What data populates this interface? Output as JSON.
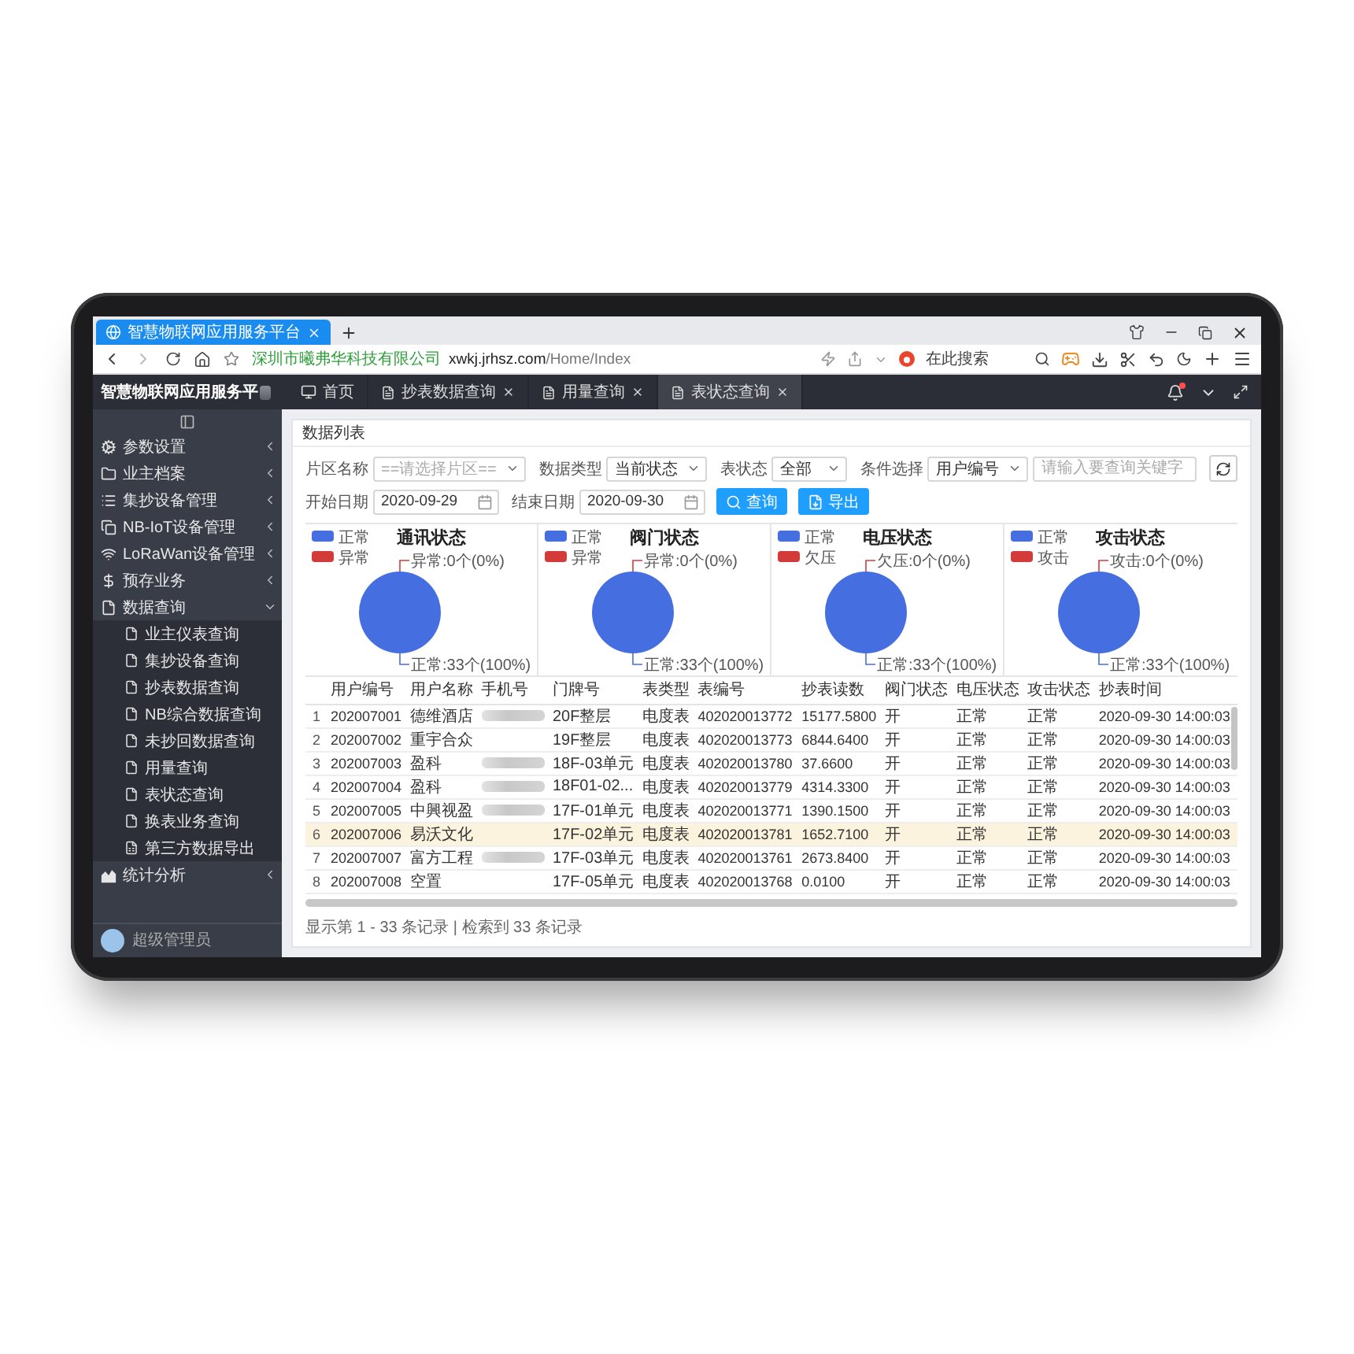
{
  "browser": {
    "tabs": [
      {
        "title": "智慧物联网应用服务平台",
        "selected": true
      }
    ],
    "address": {
      "site_name": "深圳市曦弗华科技有限公司",
      "host": "xwkj.jrhsz.com",
      "path": "/Home/Index"
    },
    "search": {
      "placeholder": "在此搜索"
    }
  },
  "app": {
    "title": "智慧物联网应用服务平",
    "tabs": [
      {
        "label": "首页",
        "kind": "home",
        "selected": false
      },
      {
        "label": "抄表数据查询",
        "kind": "page",
        "selected": false
      },
      {
        "label": "用量查询",
        "kind": "page",
        "selected": false
      },
      {
        "label": "表状态查询",
        "kind": "page",
        "selected": true
      }
    ]
  },
  "sidebar": {
    "items": [
      {
        "label": "参数设置",
        "expanded": false
      },
      {
        "label": "业主档案",
        "expanded": false
      },
      {
        "label": "集抄设备管理",
        "expanded": false
      },
      {
        "label": "NB-IoT设备管理",
        "expanded": false
      },
      {
        "label": "LoRaWan设备管理",
        "expanded": false
      },
      {
        "label": "预存业务",
        "expanded": false
      },
      {
        "label": "数据查询",
        "expanded": true,
        "children": [
          {
            "label": "业主仪表查询"
          },
          {
            "label": "集抄设备查询"
          },
          {
            "label": "抄表数据查询"
          },
          {
            "label": "NB综合数据查询"
          },
          {
            "label": "未抄回数据查询"
          },
          {
            "label": "用量查询"
          },
          {
            "label": "表状态查询"
          },
          {
            "label": "换表业务查询"
          },
          {
            "label": "第三方数据导出"
          }
        ]
      },
      {
        "label": "统计分析",
        "expanded": false
      }
    ],
    "user": {
      "name": "超级管理员"
    }
  },
  "panel": {
    "title": "数据列表",
    "filters": [
      {
        "kind": "select",
        "label": "片区名称",
        "placeholder": "==请选择片区=="
      },
      {
        "kind": "select",
        "label": "数据类型",
        "value": "当前状态"
      },
      {
        "kind": "select",
        "label": "表状态",
        "value": "全部"
      },
      {
        "kind": "select",
        "label": "条件选择",
        "value": "用户编号"
      },
      {
        "kind": "input",
        "placeholder": "请输入要查询关键字"
      },
      {
        "kind": "date",
        "label": "开始日期",
        "value": "2020-09-29"
      },
      {
        "kind": "date",
        "label": "结束日期",
        "value": "2020-09-30"
      }
    ],
    "buttons": [
      {
        "kind": "search",
        "label": "查询"
      },
      {
        "kind": "export",
        "label": "导出"
      }
    ],
    "charts": [
      {
        "chart_data": {
          "type": "pie",
          "title": "通讯状态",
          "categories": [
            "正常",
            "异常"
          ],
          "colors": [
            "#456ee0",
            "#d33a3a"
          ],
          "series": [
            {
              "values": [
                100,
                0
              ]
            }
          ],
          "value_labels": [
            "正常:33个(100%)",
            "异常:0个(0%)"
          ]
        }
      },
      {
        "chart_data": {
          "type": "pie",
          "title": "阀门状态",
          "categories": [
            "正常",
            "异常"
          ],
          "colors": [
            "#456ee0",
            "#d33a3a"
          ],
          "series": [
            {
              "values": [
                100,
                0
              ]
            }
          ],
          "value_labels": [
            "正常:33个(100%)",
            "异常:0个(0%)"
          ]
        }
      },
      {
        "chart_data": {
          "type": "pie",
          "title": "电压状态",
          "categories": [
            "正常",
            "欠压"
          ],
          "colors": [
            "#456ee0",
            "#d33a3a"
          ],
          "series": [
            {
              "values": [
                100,
                0
              ]
            }
          ],
          "value_labels": [
            "正常:33个(100%)",
            "欠压:0个(0%)"
          ]
        }
      },
      {
        "chart_data": {
          "type": "pie",
          "title": "攻击状态",
          "categories": [
            "正常",
            "攻击"
          ],
          "colors": [
            "#456ee0",
            "#d33a3a"
          ],
          "series": [
            {
              "values": [
                100,
                0
              ]
            }
          ],
          "value_labels": [
            "正常:33个(100%)",
            "攻击:0个(0%)"
          ]
        }
      }
    ],
    "table": {
      "columns": [
        "用户编号",
        "用户名称",
        "手机号",
        "门牌号",
        "表类型",
        "表编号",
        "抄表读数",
        "阀门状态",
        "电压状态",
        "攻击状态",
        "抄表时间"
      ],
      "rows": [
        {
          "no": "1",
          "user_id": "202007001",
          "name": "德维酒店",
          "phone_blurred": true,
          "room": "20F整层",
          "meter_type": "电度表",
          "meter_no": "402020013772",
          "reading": "15177.5800",
          "valve": "开",
          "voltage": "正常",
          "attack": "正常",
          "time": "2020-09-30 14:00:03",
          "selected": false
        },
        {
          "no": "2",
          "user_id": "202007002",
          "name": "重宇合众",
          "phone_blurred": false,
          "room": "19F整层",
          "meter_type": "电度表",
          "meter_no": "402020013773",
          "reading": "6844.6400",
          "valve": "开",
          "voltage": "正常",
          "attack": "正常",
          "time": "2020-09-30 14:00:03",
          "selected": false
        },
        {
          "no": "3",
          "user_id": "202007003",
          "name": "盈科",
          "phone_blurred": true,
          "room": "18F-03单元",
          "meter_type": "电度表",
          "meter_no": "402020013780",
          "reading": "37.6600",
          "valve": "开",
          "voltage": "正常",
          "attack": "正常",
          "time": "2020-09-30 14:00:03",
          "selected": false
        },
        {
          "no": "4",
          "user_id": "202007004",
          "name": "盈科",
          "phone_blurred": true,
          "room": "18F01-02...",
          "meter_type": "电度表",
          "meter_no": "402020013779",
          "reading": "4314.3300",
          "valve": "开",
          "voltage": "正常",
          "attack": "正常",
          "time": "2020-09-30 14:00:03",
          "selected": false
        },
        {
          "no": "5",
          "user_id": "202007005",
          "name": "中興视盈",
          "phone_blurred": true,
          "room": "17F-01单元",
          "meter_type": "电度表",
          "meter_no": "402020013771",
          "reading": "1390.1500",
          "valve": "开",
          "voltage": "正常",
          "attack": "正常",
          "time": "2020-09-30 14:00:03",
          "selected": false
        },
        {
          "no": "6",
          "user_id": "202007006",
          "name": "易沃文化",
          "phone_blurred": false,
          "room": "17F-02单元",
          "meter_type": "电度表",
          "meter_no": "402020013781",
          "reading": "1652.7100",
          "valve": "开",
          "voltage": "正常",
          "attack": "正常",
          "time": "2020-09-30 14:00:03",
          "selected": true
        },
        {
          "no": "7",
          "user_id": "202007007",
          "name": "富方工程",
          "phone_blurred": true,
          "room": "17F-03单元",
          "meter_type": "电度表",
          "meter_no": "402020013761",
          "reading": "2673.8400",
          "valve": "开",
          "voltage": "正常",
          "attack": "正常",
          "time": "2020-09-30 14:00:03",
          "selected": false
        },
        {
          "no": "8",
          "user_id": "202007008",
          "name": "空置",
          "phone_blurred": false,
          "room": "17F-05单元",
          "meter_type": "电度表",
          "meter_no": "402020013768",
          "reading": "0.0100",
          "valve": "开",
          "voltage": "正常",
          "attack": "正常",
          "time": "2020-09-30 14:00:03",
          "selected": false
        }
      ],
      "footer": "显示第 1 - 33 条记录 | 检索到 33 条记录"
    }
  }
}
